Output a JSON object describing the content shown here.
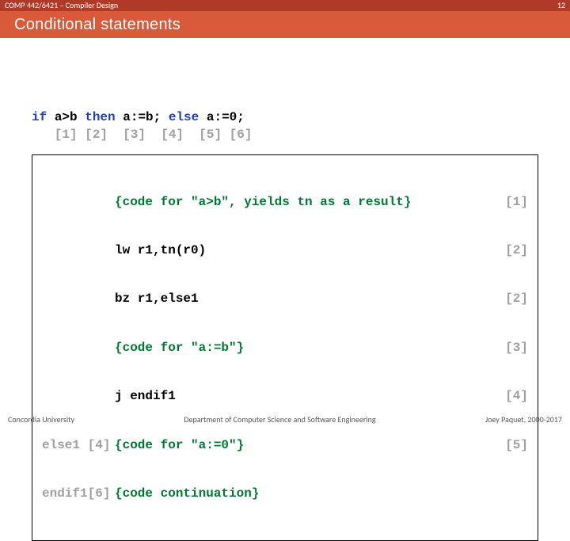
{
  "header": {
    "course": "COMP 442/6421 – Compiler Design",
    "page_number": "12"
  },
  "title": "Conditional statements",
  "source": {
    "part1_kw": "if ",
    "part1_txt": "a>b ",
    "part2_kw": "then ",
    "part2_txt": "a:=b; ",
    "part3_kw": "else ",
    "part3_txt": "a:=0;",
    "indices": "   [1] [2]  [3]  [4]  [5] [6]"
  },
  "code": {
    "labels": [
      "",
      "",
      "",
      "",
      "",
      "else1 ",
      "endif1"
    ],
    "label_idx": [
      "",
      "",
      "",
      "",
      "",
      "[4]",
      "[6]"
    ],
    "lines": [
      "{code for \"a>b\", yields tn as a result}",
      "lw r1,tn(r0)",
      "bz r1,else1",
      "{code for \"a:=b\"}",
      "j endif1",
      "{code for \"a:=0\"}",
      "{code continuation}"
    ],
    "rights": [
      "[1]",
      "[2]",
      "[2]",
      "[3]",
      "[4]",
      "[5]",
      ""
    ]
  },
  "footer": {
    "left": "Concordia University",
    "center": "Department of Computer Science and Software Engineering",
    "right": "Joey Paquet, 2000-2017"
  }
}
